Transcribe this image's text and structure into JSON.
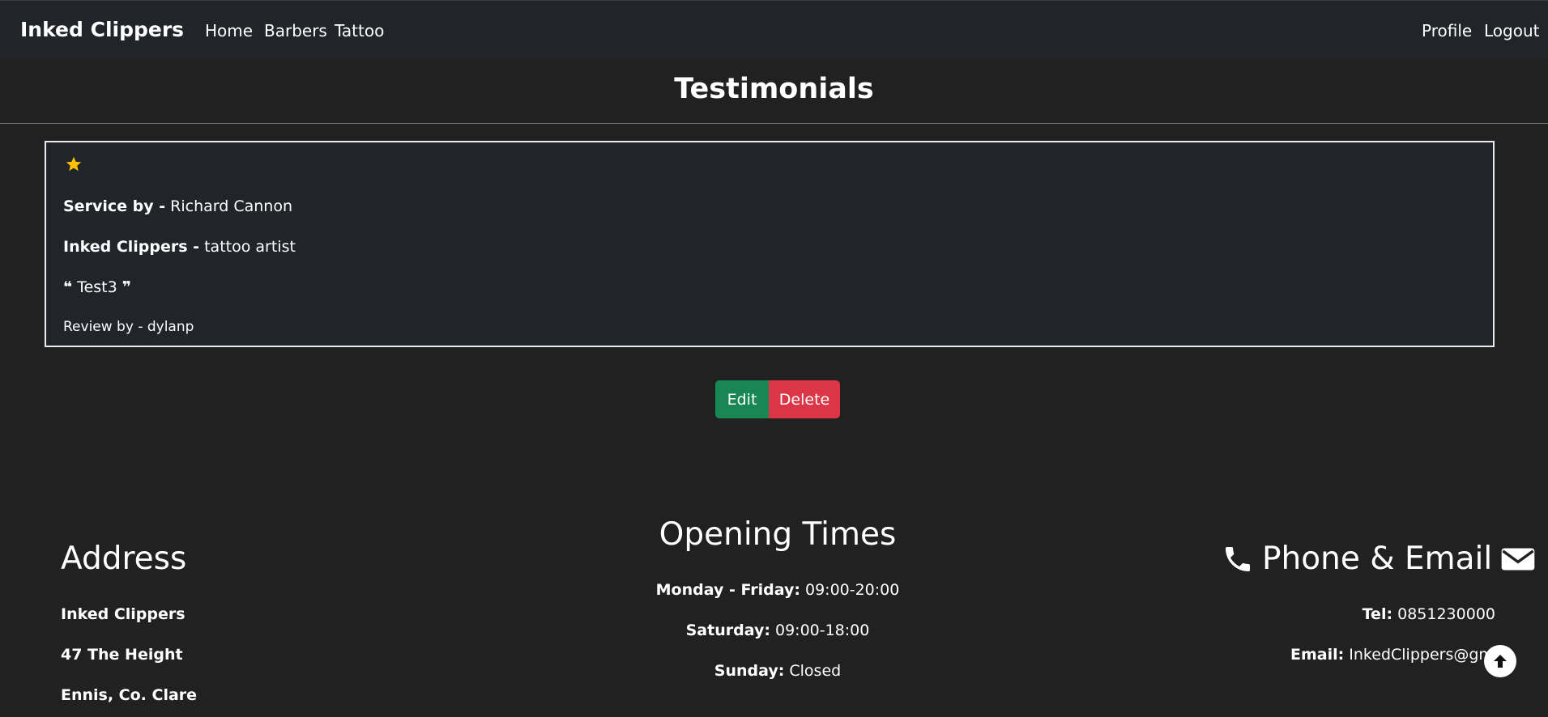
{
  "navbar": {
    "brand": "Inked Clippers",
    "left_links": [
      "Home",
      "Barbers",
      "Tattoo"
    ],
    "right_links": [
      "Profile",
      "Logout"
    ]
  },
  "page_title": "Testimonials",
  "testimonial": {
    "rating_stars": 1,
    "service_by_label": "Service by -",
    "service_by_value": "Richard Cannon",
    "shop_label": "Inked Clippers -",
    "shop_value": "tattoo artist",
    "quote": "Test3",
    "review_by": "Review by - dylanp"
  },
  "actions": {
    "edit_label": "Edit",
    "delete_label": "Delete"
  },
  "footer": {
    "address": {
      "heading": "Address",
      "lines": [
        "Inked Clippers",
        "47 The Height",
        "Ennis, Co. Clare"
      ]
    },
    "opening_times": {
      "heading": "Opening Times",
      "rows": [
        {
          "label": "Monday - Friday:",
          "value": "09:00-20:00"
        },
        {
          "label": "Saturday:",
          "value": "09:00-18:00"
        },
        {
          "label": "Sunday:",
          "value": "Closed"
        }
      ]
    },
    "contact": {
      "heading": "Phone & Email",
      "tel_label": "Tel:",
      "tel_value": "0851230000",
      "email_label": "Email:",
      "email_value": "InkedClippers@gm"
    }
  },
  "colors": {
    "background": "#212121",
    "navbar": "#212529",
    "edit_button": "#198754",
    "delete_button": "#dc3545",
    "star": "#ffc107"
  },
  "icons": {
    "star": "star-icon",
    "quote_left": "quote-left-icon",
    "quote_right": "quote-right-icon",
    "phone": "phone-icon",
    "email": "envelope-icon",
    "back_to_top": "arrow-up-icon"
  }
}
